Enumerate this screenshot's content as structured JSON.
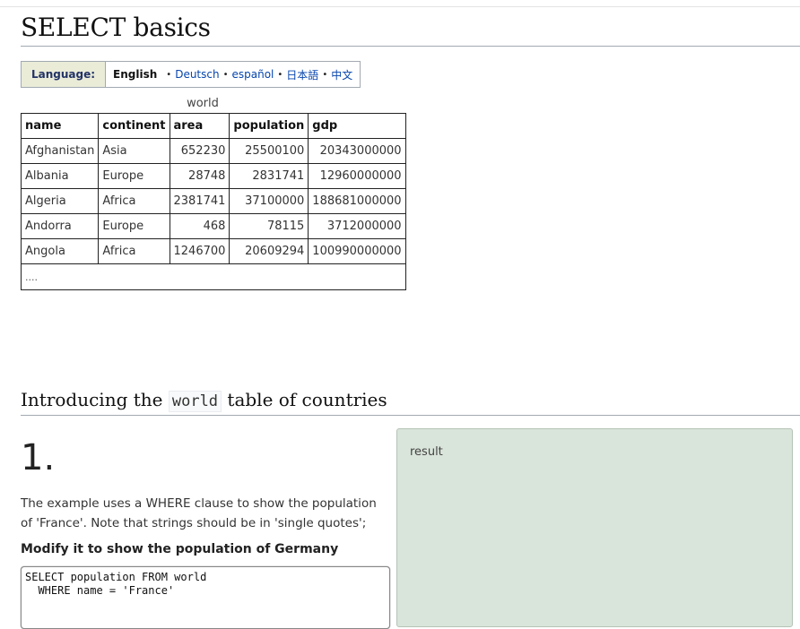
{
  "page": {
    "title": "SELECT basics"
  },
  "language": {
    "label": "Language:",
    "current": "English",
    "options": [
      "Deutsch",
      "español",
      "日本語",
      "中文"
    ]
  },
  "world_table": {
    "caption": "world",
    "headers": [
      "name",
      "continent",
      "area",
      "population",
      "gdp"
    ],
    "rows": [
      [
        "Afghanistan",
        "Asia",
        "652230",
        "25500100",
        "20343000000"
      ],
      [
        "Albania",
        "Europe",
        "28748",
        "2831741",
        "12960000000"
      ],
      [
        "Algeria",
        "Africa",
        "2381741",
        "37100000",
        "188681000000"
      ],
      [
        "Andorra",
        "Europe",
        "468",
        "78115",
        "3712000000"
      ],
      [
        "Angola",
        "Africa",
        "1246700",
        "20609294",
        "100990000000"
      ]
    ],
    "more": "...."
  },
  "section": {
    "heading_before": "Introducing the",
    "heading_code": "world",
    "heading_after": "table of countries"
  },
  "question": {
    "number": "1.",
    "description": "The example uses a WHERE clause to show the population of 'France'. Note that strings should be in 'single quotes';",
    "task": "Modify it to show the population of Germany",
    "sql": "SELECT population FROM world\n  WHERE name = 'France'"
  },
  "result": {
    "label": "result"
  }
}
